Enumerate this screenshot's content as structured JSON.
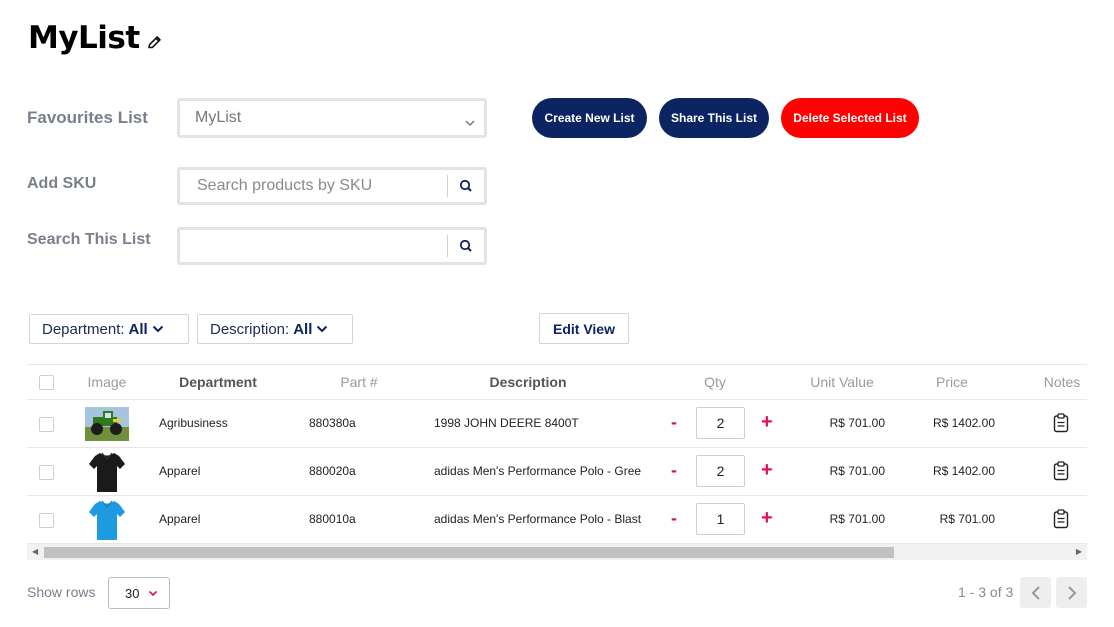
{
  "page": {
    "title": "MyList"
  },
  "form": {
    "favourites_label": "Favourites List",
    "favourites_value": "MyList",
    "add_sku_label": "Add SKU",
    "add_sku_placeholder": "Search products by SKU",
    "search_list_label": "Search This List",
    "search_list_value": ""
  },
  "actions": {
    "create": "Create New List",
    "share": "Share This List",
    "delete": "Delete Selected List"
  },
  "filters": {
    "department_label": "Department:",
    "department_value": "All",
    "description_label": "Description:",
    "description_value": "All",
    "edit_view": "Edit View"
  },
  "table": {
    "headers": {
      "image": "Image",
      "department": "Department",
      "part": "Part #",
      "description": "Description",
      "qty": "Qty",
      "unit_value": "Unit Value",
      "price": "Price",
      "notes": "Notes"
    },
    "rows": [
      {
        "image": "tractor-image",
        "department": "Agribusiness",
        "part": "880380a",
        "description": "1998 JOHN DEERE 8400T",
        "qty": "2",
        "unit_value": "R$ 701.00",
        "price": "R$ 1402.00"
      },
      {
        "image": "black-polo-shirt-image",
        "department": "Apparel",
        "part": "880020a",
        "description": "adidas Men's Performance Polo - Gree",
        "qty": "2",
        "unit_value": "R$ 701.00",
        "price": "R$ 1402.00"
      },
      {
        "image": "blue-polo-shirt-image",
        "department": "Apparel",
        "part": "880010a",
        "description": "adidas Men's Performance Polo - Blast",
        "qty": "1",
        "unit_value": "R$ 701.00",
        "price": "R$ 701.00"
      }
    ],
    "minus_label": "-",
    "plus_label": "+"
  },
  "footer": {
    "show_rows_label": "Show rows",
    "rows_value": "30",
    "page_info": "1 - 3 of 3"
  },
  "colors": {
    "navy": "#0c2461",
    "red": "#ff0000",
    "accent_pink": "#e0124e",
    "label_gray": "#7a7f8c"
  }
}
